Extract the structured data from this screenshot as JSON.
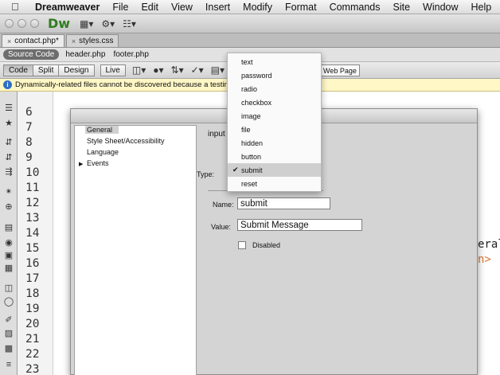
{
  "menubar": {
    "app": "Dreamweaver",
    "items": [
      "File",
      "Edit",
      "View",
      "Insert",
      "Modify",
      "Format",
      "Commands",
      "Site",
      "Window",
      "Help"
    ]
  },
  "app_header": {
    "logo": "Dw"
  },
  "doc_tabs": [
    "contact.php*",
    "styles.css"
  ],
  "related_files": {
    "source_label": "Source Code",
    "files": [
      "header.php",
      "footer.php"
    ]
  },
  "view_buttons": [
    "Code",
    "Split",
    "Design",
    "Live"
  ],
  "live_view_label": "Web Page",
  "info_bar": "Dynamically-related files cannot be discovered because a testing serv",
  "line_numbers": [
    "6",
    "7",
    "8",
    "9",
    "10",
    "11",
    "12",
    "13",
    "14",
    "15",
    "16",
    "17",
    "18",
    "19",
    "20",
    "21",
    "22",
    "23"
  ],
  "code_fragments": [
    "eral",
    "n>"
  ],
  "dialog": {
    "categories": [
      "General",
      "Style Sheet/Accessibility",
      "Language",
      "Events"
    ],
    "heading": "input",
    "type_label": "Type:",
    "name_label": "Name:",
    "name_value": "submit",
    "value_label": "Value:",
    "value_value": "Submit Message",
    "disabled_label": "Disabled"
  },
  "type_menu": {
    "items": [
      "text",
      "password",
      "radio",
      "checkbox",
      "image",
      "file",
      "hidden",
      "button",
      "submit",
      "reset"
    ],
    "selected": "submit"
  },
  "colors": {
    "dw_green": "#2f7d1f",
    "info_bg": "#fff7c6",
    "code_orange": "#e3762a"
  }
}
